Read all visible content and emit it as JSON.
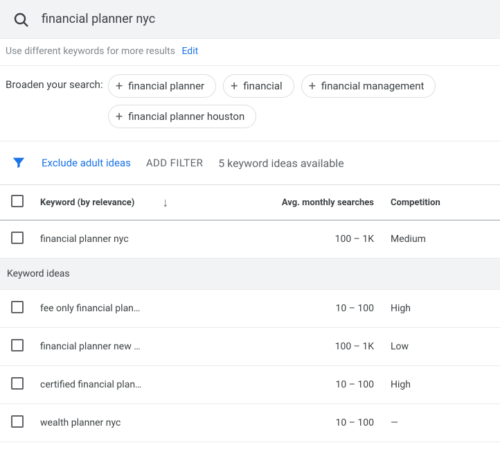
{
  "search": {
    "value": "financial planner nyc"
  },
  "hint": {
    "text": "Use different keywords for more results",
    "edit": "Edit"
  },
  "broaden": {
    "label": "Broaden your search:",
    "chips": [
      "financial planner",
      "financial",
      "financial management",
      "financial planner houston"
    ]
  },
  "filters": {
    "exclude": "Exclude adult ideas",
    "add_filter": "ADD FILTER",
    "ideas_count": "5 keyword ideas available"
  },
  "table": {
    "headers": {
      "keyword": "Keyword (by relevance)",
      "searches": "Avg. monthly searches",
      "competition": "Competition"
    },
    "primary": {
      "keyword": "financial planner nyc",
      "searches": "100 – 1K",
      "competition": "Medium"
    },
    "section_label": "Keyword ideas",
    "ideas": [
      {
        "keyword": "fee only financial plan…",
        "searches": "10 – 100",
        "competition": "High"
      },
      {
        "keyword": "financial planner new …",
        "searches": "100 – 1K",
        "competition": "Low"
      },
      {
        "keyword": "certified financial plan…",
        "searches": "10 – 100",
        "competition": "High"
      },
      {
        "keyword": "wealth planner nyc",
        "searches": "10 – 100",
        "competition": "—"
      }
    ]
  }
}
